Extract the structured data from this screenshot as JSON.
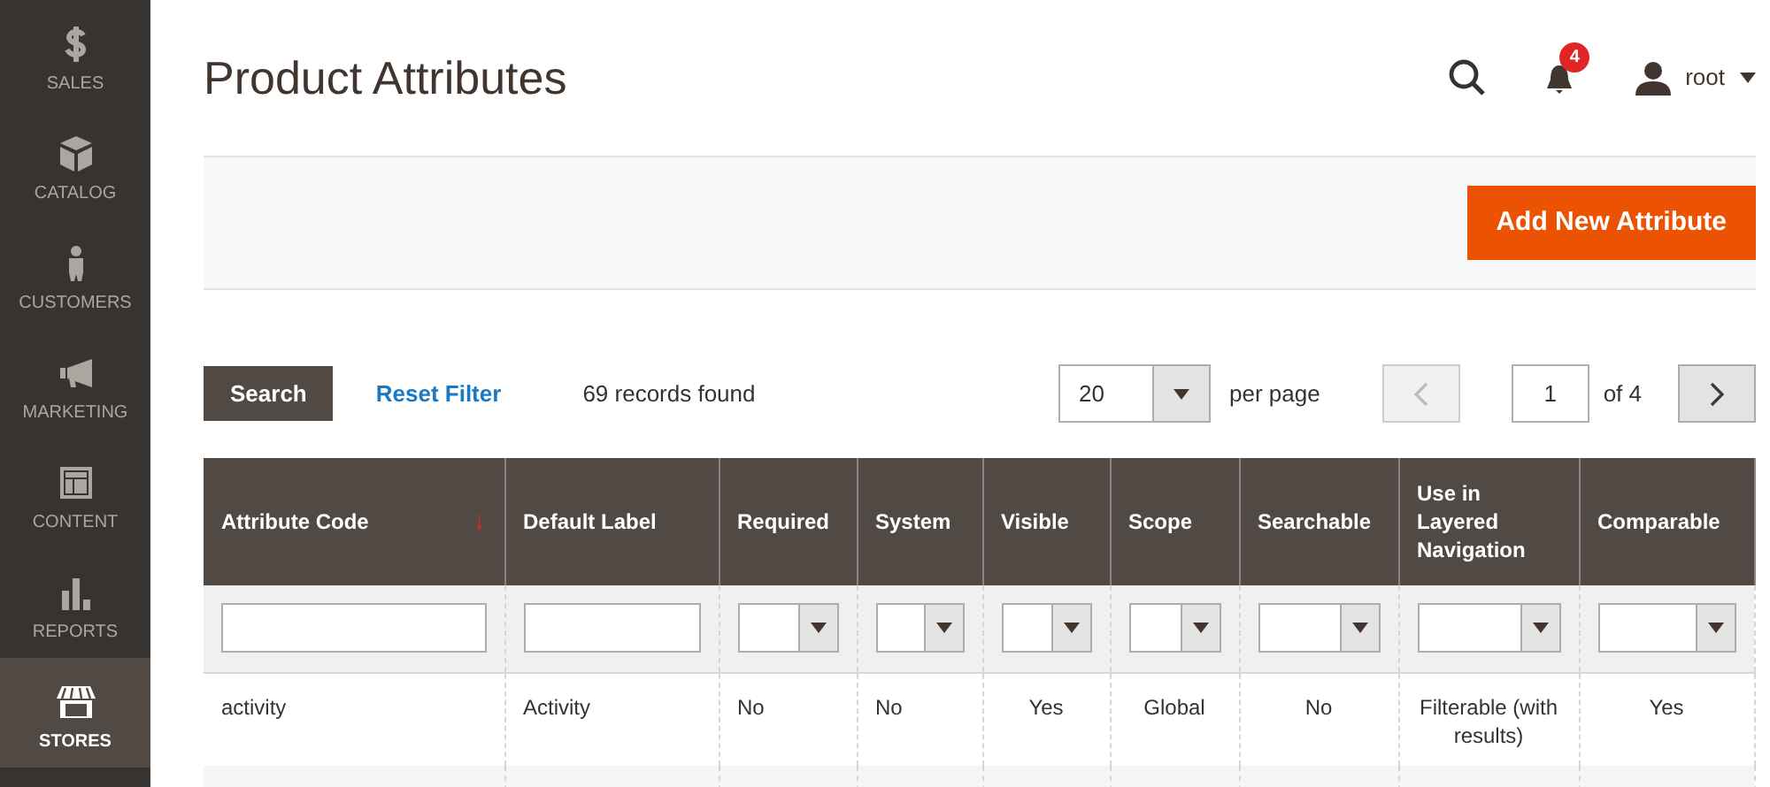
{
  "sidebar": {
    "items": [
      {
        "label": "SALES",
        "selected": false
      },
      {
        "label": "CATALOG",
        "selected": false
      },
      {
        "label": "CUSTOMERS",
        "selected": false
      },
      {
        "label": "MARKETING",
        "selected": false
      },
      {
        "label": "CONTENT",
        "selected": false
      },
      {
        "label": "REPORTS",
        "selected": false
      },
      {
        "label": "STORES",
        "selected": true
      }
    ]
  },
  "header": {
    "title": "Product Attributes",
    "notifications": "4",
    "user": "root"
  },
  "actions": {
    "add_button": "Add New Attribute"
  },
  "toolbar": {
    "search_button": "Search",
    "reset_link": "Reset Filter",
    "records": "69 records found",
    "per_page_value": "20",
    "per_page_label": "per page",
    "page": "1",
    "page_total": "of 4",
    "prev_disabled": true,
    "next_disabled": false
  },
  "table": {
    "columns": [
      {
        "label": "Attribute Code",
        "sort_indicator": "↓",
        "kind": "text"
      },
      {
        "label": "Default Label",
        "kind": "text"
      },
      {
        "label": "Required",
        "kind": "select"
      },
      {
        "label": "System",
        "kind": "select"
      },
      {
        "label": "Visible",
        "kind": "select"
      },
      {
        "label": "Scope",
        "kind": "select"
      },
      {
        "label": "Searchable",
        "kind": "select"
      },
      {
        "label": "Use in Layered Navigation",
        "kind": "select"
      },
      {
        "label": "Comparable",
        "kind": "select"
      }
    ],
    "rows": [
      [
        "activity",
        "Activity",
        "No",
        "No",
        "Yes",
        "Global",
        "No",
        "Filterable (with results)",
        "Yes"
      ]
    ]
  }
}
